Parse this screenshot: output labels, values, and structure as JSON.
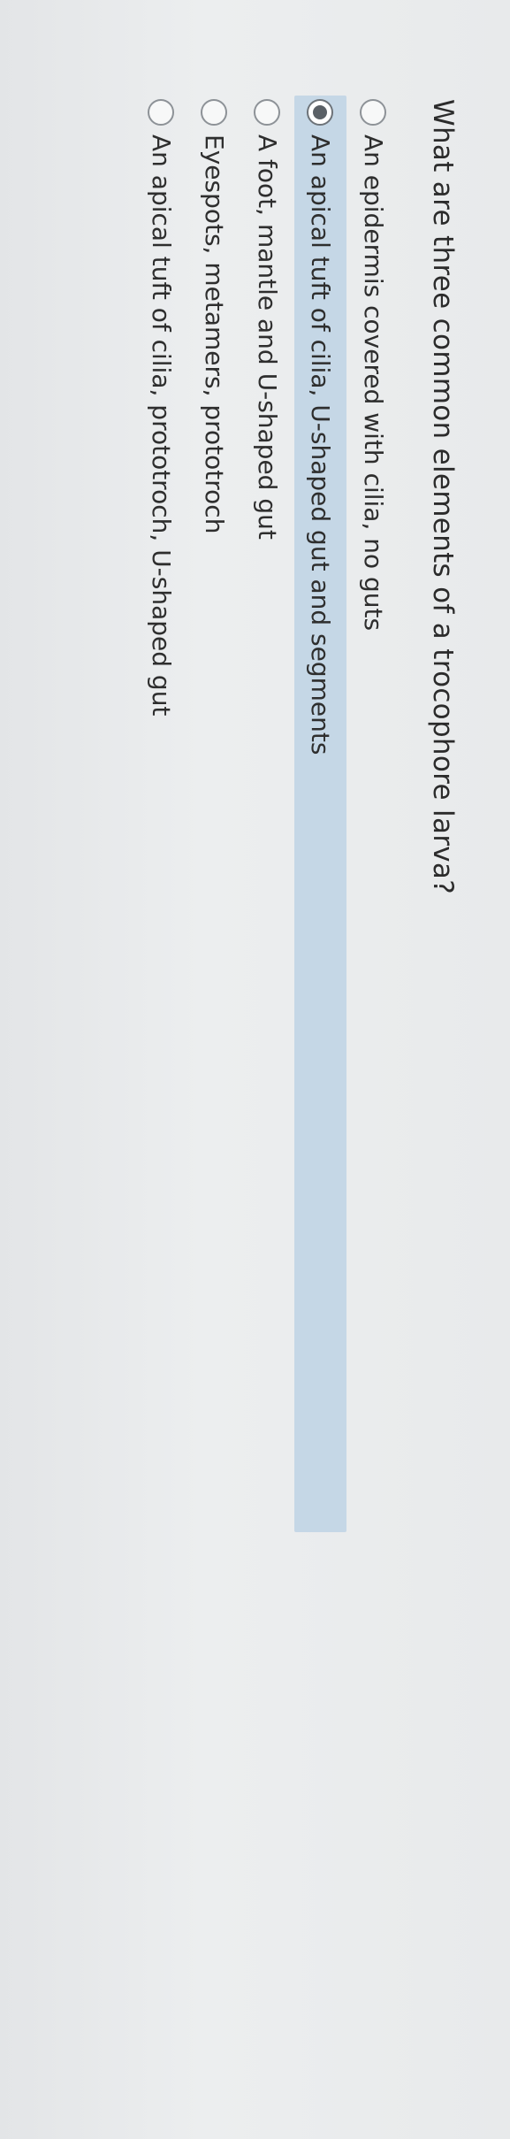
{
  "question": {
    "text": "What are three common elements of a trocophore larva?"
  },
  "options": [
    {
      "label": "An epidermis covered with cilia, no guts",
      "selected": false
    },
    {
      "label": "An apical tuft of cilia, U-shaped gut and segments",
      "selected": true
    },
    {
      "label": "A foot, mantle and U-shaped gut",
      "selected": false
    },
    {
      "label": "Eyespots, metamers, prototroch",
      "selected": false
    },
    {
      "label": "An apical tuft of cilia, prototroch, U-shaped gut",
      "selected": false
    }
  ],
  "colors": {
    "selected_highlight": "#c5d7e6",
    "background": "#e9ebec",
    "text": "#2b2b2b"
  },
  "icons": {
    "unselected": "radio-button-empty-icon",
    "selected": "radio-button-filled-icon"
  }
}
